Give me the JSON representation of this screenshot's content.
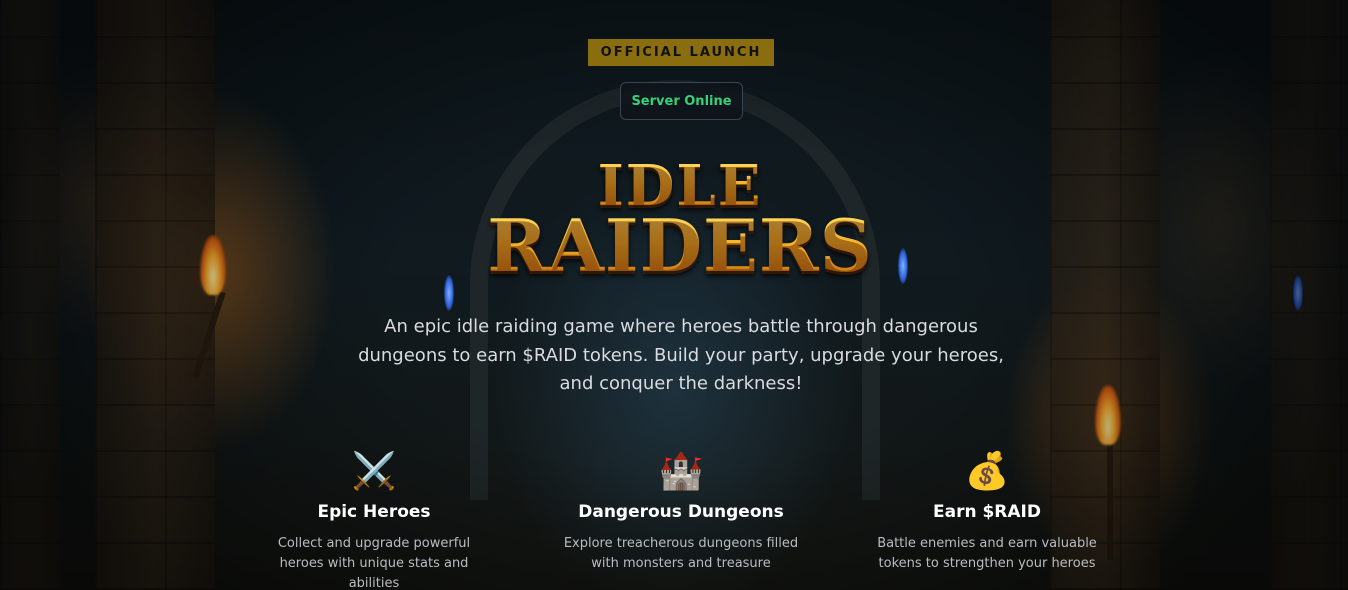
{
  "badge": {
    "label": "OFFICIAL LAUNCH"
  },
  "server_status": {
    "label": "Server Online",
    "color": "#35d17a"
  },
  "logo": {
    "line1": "IDLE",
    "line2": "RAIDERS"
  },
  "tagline": "An epic idle raiding game where heroes battle through dangerous dungeons to earn $RAID tokens. Build your party, upgrade your heroes, and conquer the darkness!",
  "features": [
    {
      "icon": "⚔️",
      "icon_name": "crossed-swords-icon",
      "title": "Epic Heroes",
      "description": "Collect and upgrade powerful heroes with unique stats and abilities"
    },
    {
      "icon": "🏰",
      "icon_name": "castle-icon",
      "title": "Dangerous Dungeons",
      "description": "Explore treacherous dungeons filled with monsters and treasure"
    },
    {
      "icon": "💰",
      "icon_name": "money-bag-icon",
      "title": "Earn $RAID",
      "description": "Battle enemies and earn valuable tokens to strengthen your heroes"
    }
  ],
  "colors": {
    "accent_gold": "#f3b320",
    "badge_bg": "#8a6d0e"
  }
}
